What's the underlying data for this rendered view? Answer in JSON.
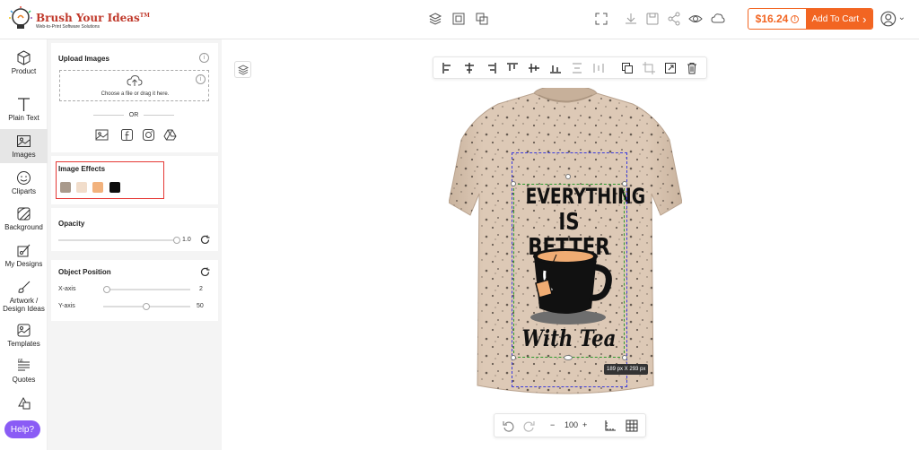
{
  "brand": {
    "title": "Brush Your Ideas",
    "tm": "TM",
    "tagline": "Web-to-Print Software Solutions"
  },
  "header": {
    "price": "$16.24",
    "price_info": "!",
    "cart_label": "Add To Cart",
    "cart_arrow": "›",
    "user_caret": "⌄"
  },
  "rail": {
    "items": [
      {
        "label": "Product"
      },
      {
        "label": "Plain Text"
      },
      {
        "label": "Images"
      },
      {
        "label": "Cliparts"
      },
      {
        "label": "Background"
      },
      {
        "label": "My Designs"
      },
      {
        "label": "Artwork /"
      },
      {
        "label": "Design Ideas"
      },
      {
        "label": "Templates"
      },
      {
        "label": "Quotes"
      }
    ],
    "help": "Help?"
  },
  "panel": {
    "upload_title": "Upload Images",
    "info": "i",
    "drop_text": "Choose a file or drag it here.",
    "or": "OR",
    "effects_title": "Image Effects",
    "effects_colors": [
      "#a99a8c",
      "#f1ddcb",
      "#f2b27d",
      "#0d0d0d"
    ],
    "opacity_title": "Opacity",
    "opacity_value": "1.0",
    "opacity_fraction": 1.0,
    "position_title": "Object Position",
    "x_label": "X-axis",
    "x_value": "2",
    "y_label": "Y-axis",
    "y_value": "50"
  },
  "canvas": {
    "design_line1": "EVERYTHING",
    "design_line2": "IS BETTER",
    "design_line3": "With Tea",
    "dimensions": "189 px X 293 px",
    "zoom": "100",
    "minus": "−",
    "plus": "+"
  },
  "colors": {
    "accent": "#f26522",
    "help": "#8a5cf5",
    "shirt": "#ddc9b6",
    "highlight": "#e53935"
  }
}
